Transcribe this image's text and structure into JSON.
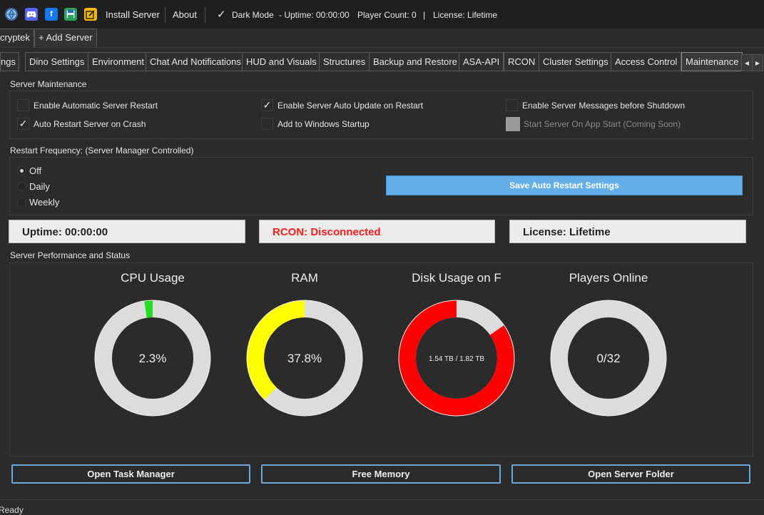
{
  "toolbar": {
    "install_server": "Install Server",
    "about": "About",
    "dark_mode": "Dark Mode",
    "dark_mode_checked": true,
    "uptime": "- Uptime: 00:00:00",
    "player_count": "Player Count: 0",
    "separator": "|",
    "license": "License: Lifetime"
  },
  "server_tabs": [
    "cryptek",
    "+ Add Server"
  ],
  "settings_tabs": [
    "ings",
    "Dino Settings",
    "Environment",
    "Chat And Notifications",
    "HUD and Visuals",
    "Structures",
    "Backup and Restore",
    "ASA-API",
    "RCON",
    "Cluster Settings",
    "Access Control",
    "Maintenance"
  ],
  "active_tab": "Maintenance",
  "maintenance": {
    "title": "Server Maintenance",
    "enable_auto_restart": {
      "label": "Enable Automatic Server Restart",
      "checked": false
    },
    "auto_restart_crash": {
      "label": "Auto Restart Server on Crash",
      "checked": true
    },
    "auto_update": {
      "label": "Enable Server Auto Update on Restart",
      "checked": true
    },
    "windows_startup": {
      "label": "Add to Windows Startup",
      "checked": false
    },
    "shutdown_messages": {
      "label": "Enable Server Messages before Shutdown",
      "checked": false
    },
    "start_on_app": {
      "label": "Start Server On App Start (Coming Soon)",
      "checked": false,
      "disabled": true
    },
    "check_mark": "✓"
  },
  "restart": {
    "title": "Restart Frequency: (Server Manager Controlled)",
    "options": [
      "Off",
      "Daily",
      "Weekly"
    ],
    "selected": "Off",
    "save_button": "Save Auto Restart Settings"
  },
  "status": {
    "uptime": "Uptime: 00:00:00",
    "rcon": "RCON: Disconnected",
    "rcon_color": "#ff1a1a",
    "license": "License: Lifetime"
  },
  "performance": {
    "title": "Server Performance and Status",
    "charts": [
      {
        "title": "CPU Usage",
        "label": "2.3%",
        "fraction": 0.023,
        "color": "#22dd22"
      },
      {
        "title": "RAM",
        "label": "37.8%",
        "fraction": 0.378,
        "color": "#ffff00"
      },
      {
        "title": "Disk Usage on F",
        "label": "1.54 TB / 1.82 TB",
        "fraction": 0.846,
        "color": "#ff0000"
      },
      {
        "title": "Players Online",
        "label": "0/32",
        "fraction": 0.0,
        "color": "#22dd22"
      }
    ],
    "track_color": "#dcdcdc"
  },
  "actions": {
    "task_manager": "Open Task Manager",
    "free_memory": "Free Memory",
    "server_folder": "Open Server Folder"
  },
  "status_bar": "Ready"
}
